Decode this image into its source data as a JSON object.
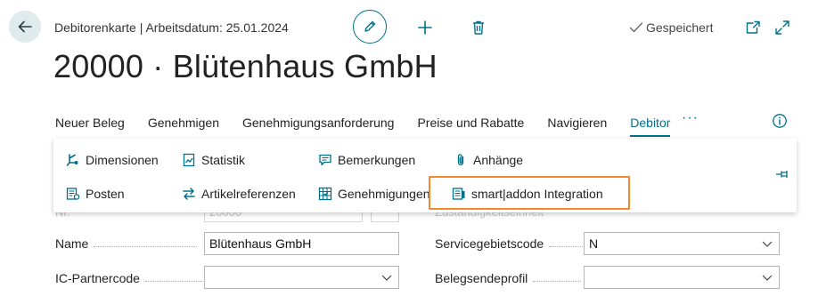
{
  "header": {
    "breadcrumb": "Debitorenkarte | Arbeitsdatum: 25.01.2024",
    "saved_status": "Gespeichert",
    "title": "20000 · Blütenhaus GmbH",
    "icons": [
      "back-arrow-icon",
      "pencil-icon",
      "plus-icon",
      "trash-icon",
      "check-icon",
      "popout-icon",
      "expand-icon"
    ]
  },
  "actionbar": {
    "items": [
      "Neuer Beleg",
      "Genehmigen",
      "Genehmigungsanforderung",
      "Preise und Rabatte",
      "Navigieren",
      "Debitor"
    ],
    "active": "Debitor",
    "more": "···"
  },
  "dropdown": {
    "items": [
      {
        "label": "Dimensionen",
        "icon": "dimensions-icon"
      },
      {
        "label": "Statistik",
        "icon": "statistics-icon"
      },
      {
        "label": "Bemerkungen",
        "icon": "comments-icon"
      },
      {
        "label": "Anhänge",
        "icon": "paperclip-icon"
      },
      {
        "label": "Posten",
        "icon": "entries-icon"
      },
      {
        "label": "Artikelreferenzen",
        "icon": "swap-arrows-icon"
      },
      {
        "label": "Genehmigungen",
        "icon": "approvals-icon"
      },
      {
        "label": "smart|addon Integration",
        "icon": "integration-icon"
      }
    ],
    "highlighted": "smart|addon Integration"
  },
  "form": {
    "hidden_no_label": "Nr.",
    "hidden_no_value": "20000",
    "hidden_right_label": "Zuständigkeitseinheit",
    "name_label": "Name",
    "name_value": "Blütenhaus GmbH",
    "ic_partner_label": "IC-Partnercode",
    "ic_partner_value": "",
    "service_zone_label": "Servicegebietscode",
    "service_zone_value": "N",
    "doc_profile_label": "Belegsendeprofil",
    "doc_profile_value": ""
  },
  "colors": {
    "accent": "#00708a",
    "highlight": "#f08a2d",
    "back_button_bg": "#dfeaed"
  }
}
